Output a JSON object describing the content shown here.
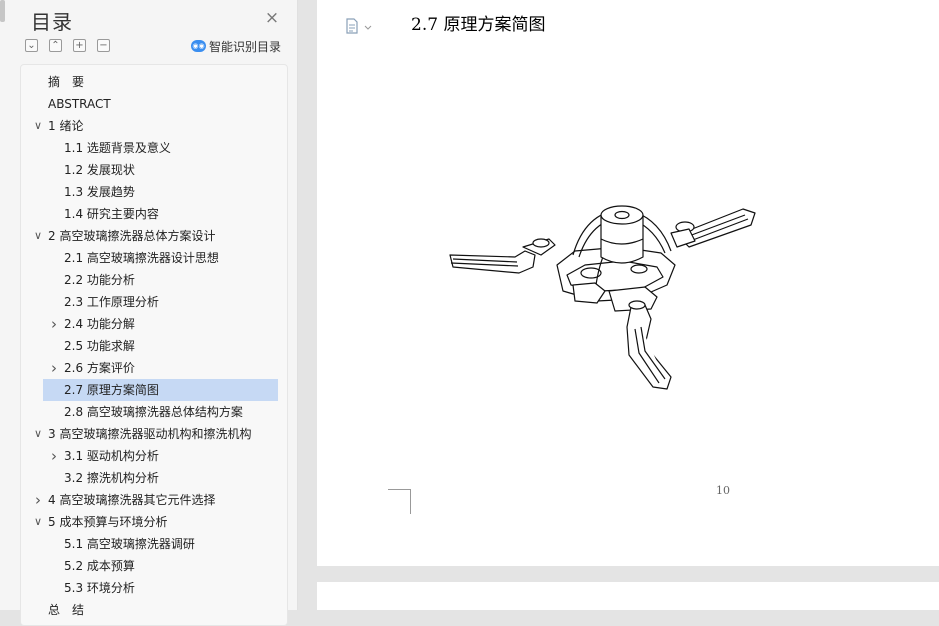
{
  "toc": {
    "title": "目录",
    "close_icon": "×",
    "toolbar": {
      "collapse": "⌄",
      "expand": "⌃",
      "add": "+",
      "remove": "−",
      "smart_label": "智能识别目录",
      "smart_icon": "ai"
    },
    "items": [
      {
        "label": "摘　要",
        "level": 0,
        "chevron": ""
      },
      {
        "label": "ABSTRACT",
        "level": 0,
        "chevron": ""
      },
      {
        "label": "1  绪论",
        "level": 0,
        "chevron": "expanded"
      },
      {
        "label": "1.1 选题背景及意义",
        "level": 1,
        "chevron": ""
      },
      {
        "label": "1.2 发展现状",
        "level": 1,
        "chevron": ""
      },
      {
        "label": "1.3 发展趋势",
        "level": 1,
        "chevron": ""
      },
      {
        "label": "1.4 研究主要内容",
        "level": 1,
        "chevron": ""
      },
      {
        "label": "2  高空玻璃擦洗器总体方案设计",
        "level": 0,
        "chevron": "expanded"
      },
      {
        "label": "2.1  高空玻璃擦洗器设计思想",
        "level": 1,
        "chevron": ""
      },
      {
        "label": "2.2 功能分析",
        "level": 1,
        "chevron": ""
      },
      {
        "label": "2.3 工作原理分析",
        "level": 1,
        "chevron": ""
      },
      {
        "label": "2.4 功能分解",
        "level": 1,
        "chevron": "collapsed"
      },
      {
        "label": "2.5 功能求解",
        "level": 1,
        "chevron": ""
      },
      {
        "label": "2.6 方案评价",
        "level": 1,
        "chevron": "collapsed"
      },
      {
        "label": "2.7 原理方案简图",
        "level": 1,
        "chevron": "",
        "selected": true
      },
      {
        "label": "2.8  高空玻璃擦洗器总体结构方案",
        "level": 1,
        "chevron": ""
      },
      {
        "label": "3  高空玻璃擦洗器驱动机构和擦洗机构",
        "level": 0,
        "chevron": "expanded"
      },
      {
        "label": "3.1  驱动机构分析",
        "level": 1,
        "chevron": "collapsed"
      },
      {
        "label": "3.2 擦洗机构分析",
        "level": 1,
        "chevron": ""
      },
      {
        "label": "4  高空玻璃擦洗器其它元件选择",
        "level": 0,
        "chevron": "collapsed"
      },
      {
        "label": "5  成本预算与环境分析",
        "level": 0,
        "chevron": "expanded"
      },
      {
        "label": "5.1  高空玻璃擦洗器调研",
        "level": 1,
        "chevron": ""
      },
      {
        "label": "5.2  成本预算",
        "level": 1,
        "chevron": ""
      },
      {
        "label": "5.3  环境分析",
        "level": 1,
        "chevron": ""
      },
      {
        "label": "总　结",
        "level": 0,
        "chevron": ""
      }
    ]
  },
  "document": {
    "heading": "2.7 原理方案简图",
    "page_number": "10",
    "doc_icon": "document-icon",
    "figure": "line-drawing-of-three-arm-wiper-mechanism"
  },
  "colors": {
    "selected_bg": "#c6d9f4",
    "accent": "#3a8ef0",
    "panel_bg": "#f5f5f5",
    "doc_bg": "#e4e4e4"
  }
}
